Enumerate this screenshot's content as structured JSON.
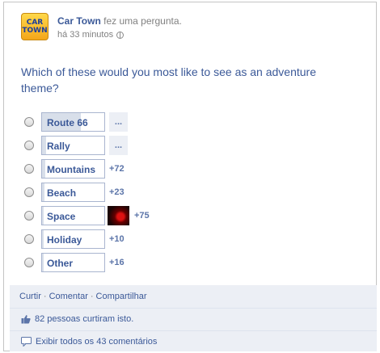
{
  "post": {
    "logo_line1": "CAR",
    "logo_line2": "TOWN",
    "author": "Car Town",
    "action": "fez uma pergunta.",
    "time": "há 33 minutos"
  },
  "question": "Which of these would you most like to see as an adventure theme?",
  "options": [
    {
      "label": "Route 66",
      "votes": "...",
      "fill": 0.62
    },
    {
      "label": "Rally",
      "votes": "...",
      "fill": 0.06
    },
    {
      "label": "Mountains",
      "votes": "+72",
      "fill": 0.05
    },
    {
      "label": "Beach",
      "votes": "+23",
      "fill": 0.04
    },
    {
      "label": "Space",
      "votes": "+75",
      "fill": 0.03
    },
    {
      "label": "Holiday",
      "votes": "+10",
      "fill": 0.03
    },
    {
      "label": "Other",
      "votes": "+16",
      "fill": 0.03
    }
  ],
  "footer": {
    "like": "Curtir",
    "comment": "Comentar",
    "share": "Compartilhar",
    "separator": "·",
    "likes_text": "82 pessoas curtiram isto.",
    "comments_text": "Exibir todos os 43 comentários"
  },
  "colors": {
    "link": "#3b5998",
    "bar_fill": "#d8dfea",
    "footer_bg": "#eceff5"
  }
}
